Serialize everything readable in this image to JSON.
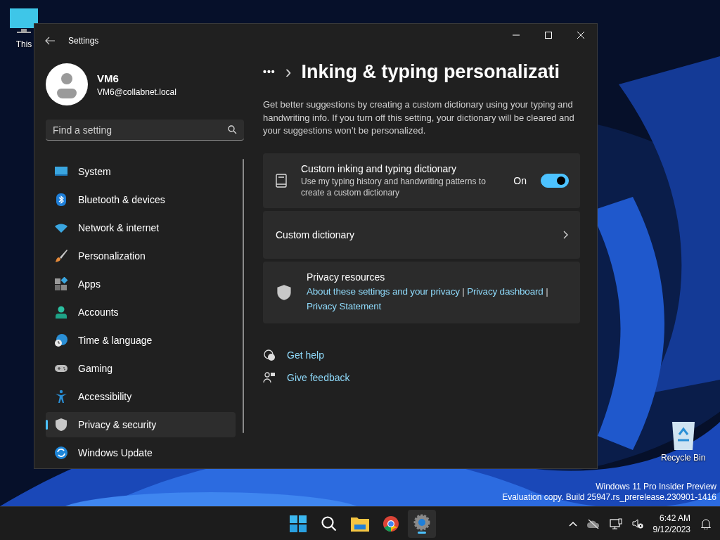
{
  "desktop": {
    "icons": [
      {
        "label": "This"
      },
      {
        "label": "Recycle Bin"
      }
    ],
    "watermark": [
      "Windows 11 Pro Insider Preview",
      "Evaluation copy. Build 25947.rs_prerelease.230901-1416"
    ]
  },
  "window": {
    "title": "Settings"
  },
  "account": {
    "name": "VM6",
    "email": "VM6@collabnet.local"
  },
  "search": {
    "placeholder": "Find a setting"
  },
  "sidebar": {
    "items": [
      {
        "label": "System",
        "selected": false
      },
      {
        "label": "Bluetooth & devices",
        "selected": false
      },
      {
        "label": "Network & internet",
        "selected": false
      },
      {
        "label": "Personalization",
        "selected": false
      },
      {
        "label": "Apps",
        "selected": false
      },
      {
        "label": "Accounts",
        "selected": false
      },
      {
        "label": "Time & language",
        "selected": false
      },
      {
        "label": "Gaming",
        "selected": false
      },
      {
        "label": "Accessibility",
        "selected": false
      },
      {
        "label": "Privacy & security",
        "selected": true
      },
      {
        "label": "Windows Update",
        "selected": false
      }
    ]
  },
  "breadcrumb": {
    "more": "•••",
    "separator": "›",
    "title": "Inking & typing personalizati"
  },
  "description": "Get better suggestions by creating a custom dictionary using your typing and handwriting info. If you turn off this setting, your dictionary will be cleared and your suggestions won’t be personalized.",
  "cards": [
    {
      "kind": "toggle",
      "title": "Custom inking and typing dictionary",
      "subtitle": "Use my typing history and handwriting patterns to create a custom dictionary",
      "state_label": "On",
      "on": true
    },
    {
      "kind": "link",
      "title": "Custom dictionary"
    },
    {
      "kind": "resources",
      "title": "Privacy resources",
      "links": [
        "About these settings and your privacy",
        "Privacy dashboard",
        "Privacy Statement"
      ],
      "separator": "|"
    }
  ],
  "help_links": [
    "Get help",
    "Give feedback"
  ],
  "taskbar": {
    "time": "6:42 AM",
    "date": "9/12/2023"
  }
}
